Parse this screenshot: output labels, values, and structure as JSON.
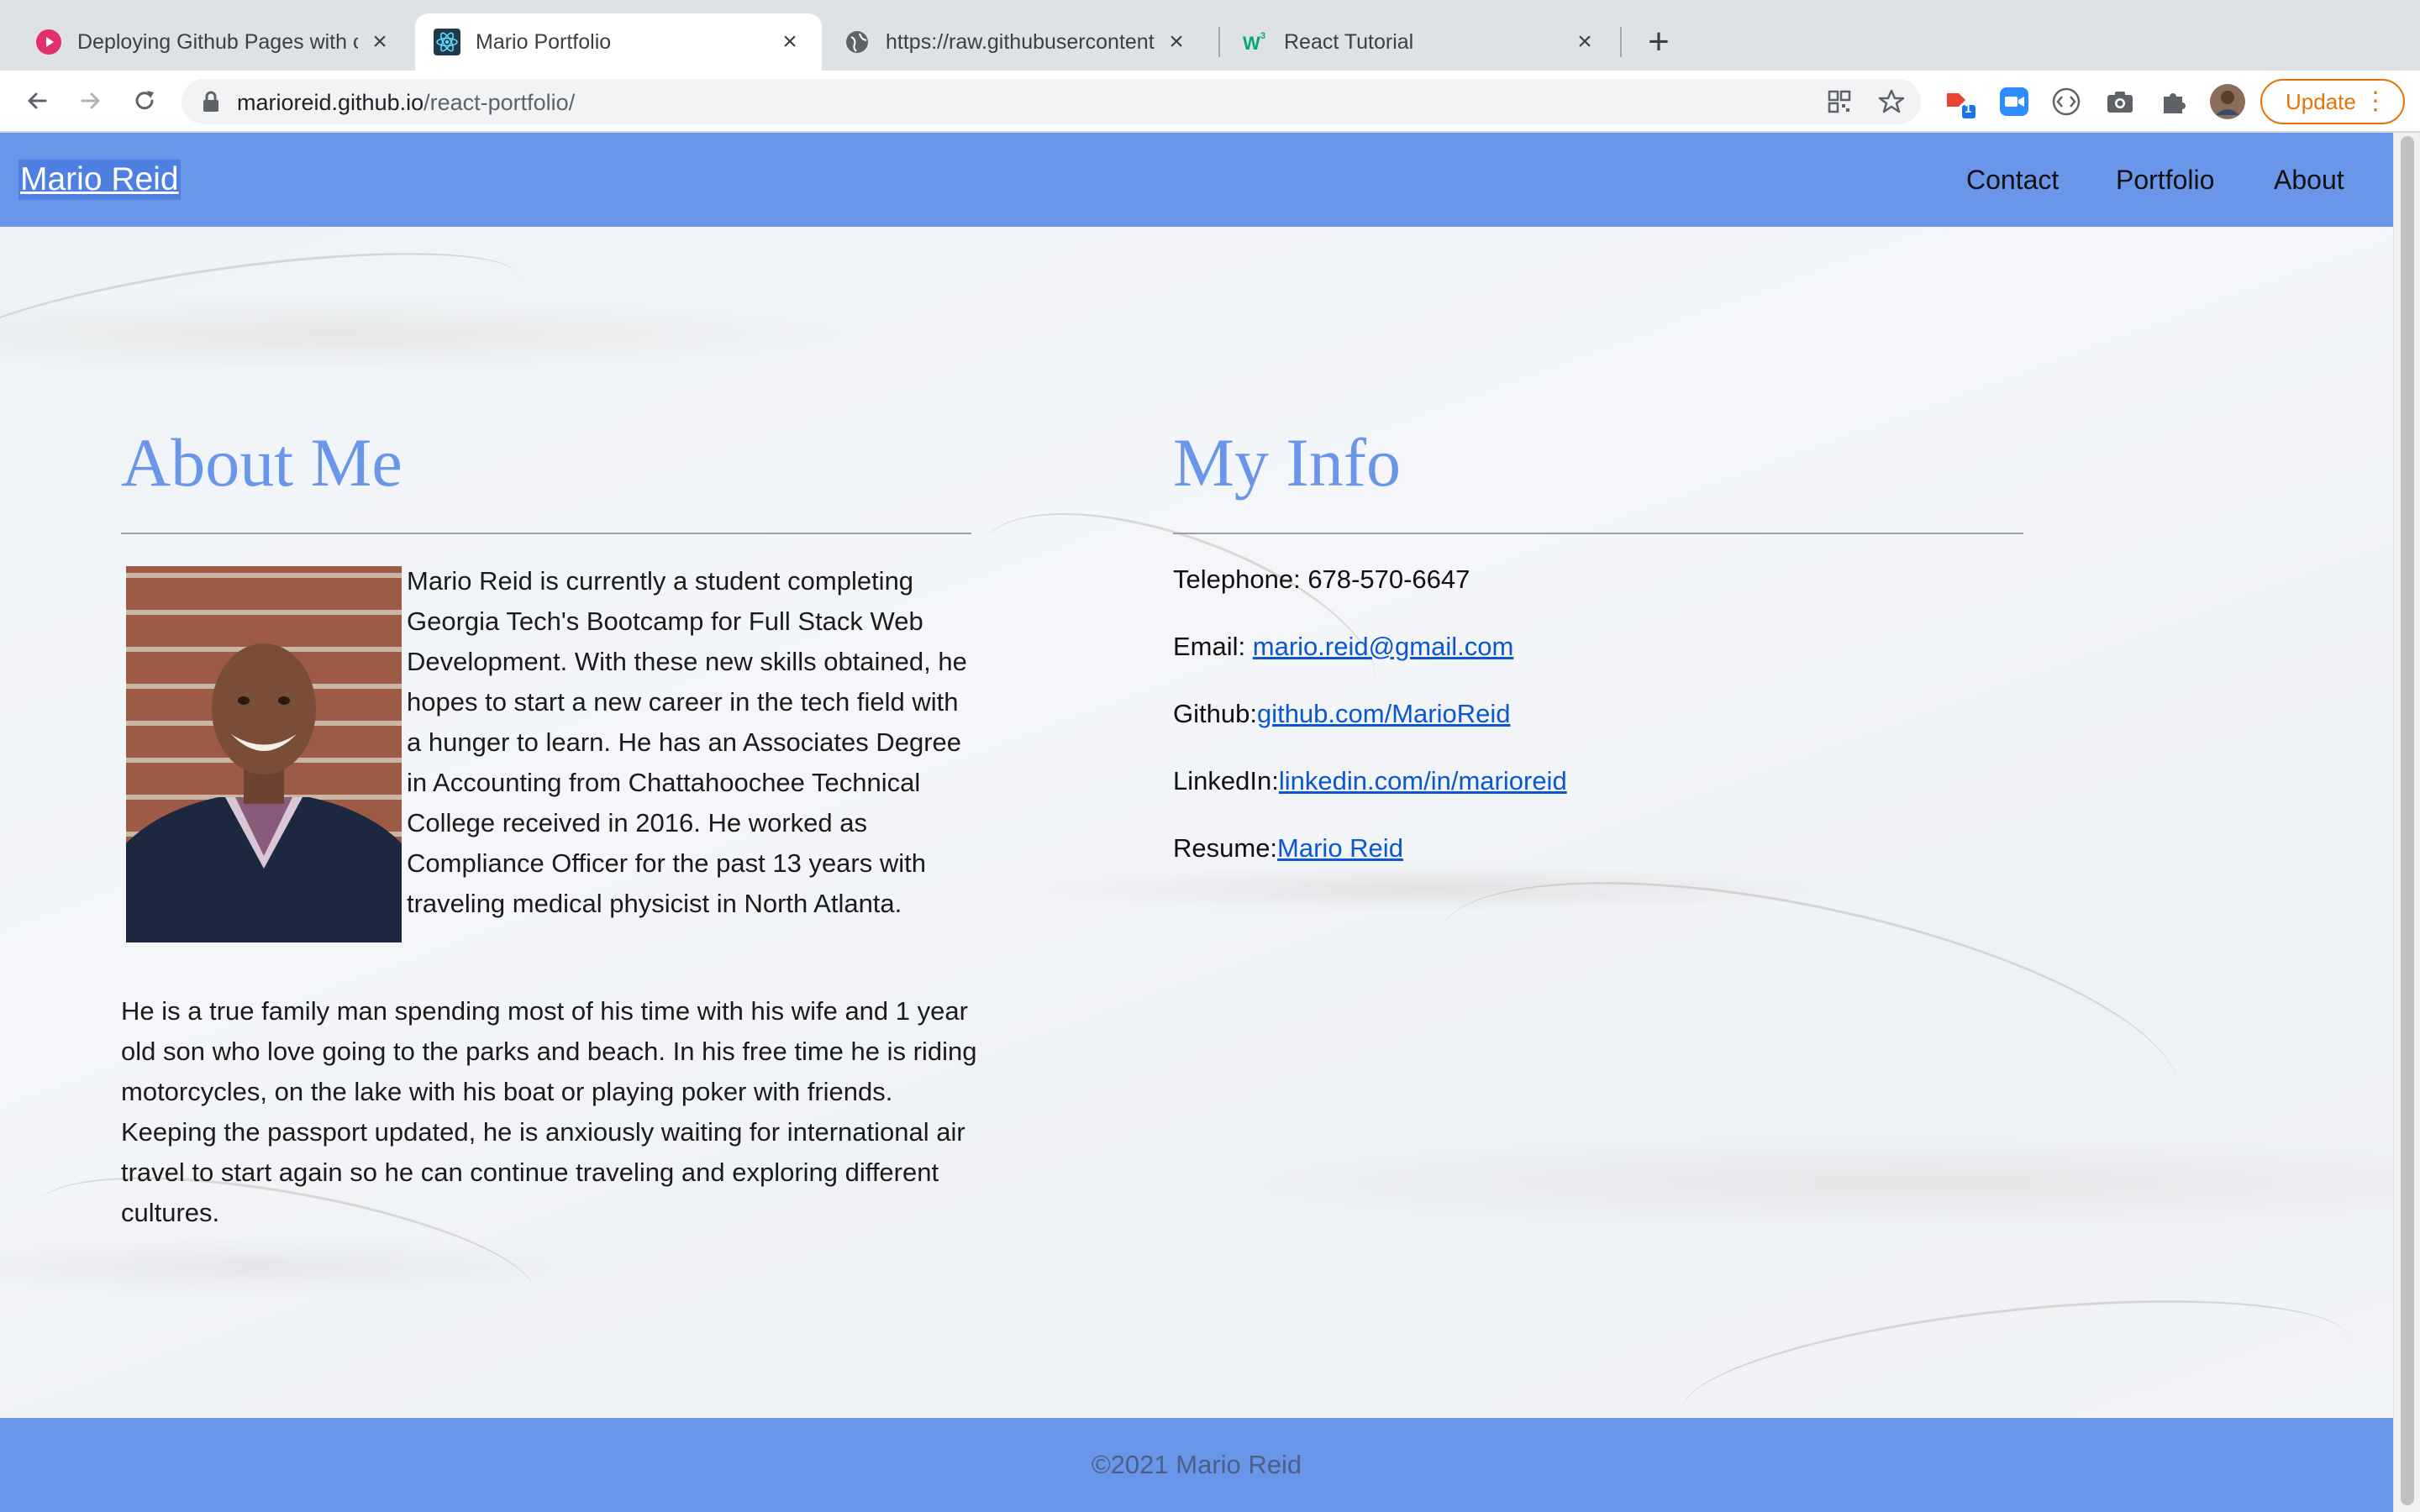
{
  "browser": {
    "tabs": [
      {
        "title": "Deploying Github Pages with c",
        "favicon": "youtube-icon",
        "active": false
      },
      {
        "title": "Mario Portfolio",
        "favicon": "react-icon",
        "active": true
      },
      {
        "title": "https://raw.githubusercontent.c",
        "favicon": "globe-icon",
        "active": false
      },
      {
        "title": "React Tutorial",
        "favicon": "w3schools-icon",
        "active": false
      }
    ],
    "address": {
      "host": "marioreid.github.io",
      "path": "/react-portfolio/"
    },
    "extension_badge": "1",
    "update_label": "Update",
    "colors": {
      "update": "#e8710a",
      "tab_strip": "#dee1e6"
    }
  },
  "site": {
    "brand": "Mario Reid",
    "nav": [
      {
        "label": "Contact"
      },
      {
        "label": "Portfolio"
      },
      {
        "label": "About"
      }
    ],
    "colors": {
      "nav_bg": "#6a96ea",
      "heading": "#6a96ea",
      "link": "#0b57d0"
    }
  },
  "about": {
    "title": "About Me",
    "paragraph1": "Mario Reid is currently a student completing Georgia Tech's Bootcamp for Full Stack Web Development. With these new skills obtained, he hopes to start a new career in the tech field with a hunger to learn. He has an Associates Degree in Accounting from Chattahoochee Technical College received in 2016. He worked as Compliance Officer for the past 13 years with traveling medical physicist in North Atlanta.",
    "paragraph2": "He is a true family man spending most of his time with his wife and 1 year old son who love going to the parks and beach. In his free time he is riding motorcycles, on the lake with his boat or playing poker with friends. Keeping the passport updated, he is anxiously waiting for international air travel to start again so he can continue traveling and exploring different cultures."
  },
  "info": {
    "title": "My Info",
    "telephone_label": "Telephone: ",
    "telephone": "678-570-6647",
    "email_label": "Email: ",
    "email": "mario.reid@gmail.com",
    "github_label": "Github:",
    "github": "github.com/MarioReid",
    "linkedin_label": "LinkedIn:",
    "linkedin": "linkedin.com/in/marioreid",
    "resume_label": "Resume:",
    "resume": "Mario Reid"
  },
  "footer": {
    "text": "©2021 Mario Reid"
  }
}
